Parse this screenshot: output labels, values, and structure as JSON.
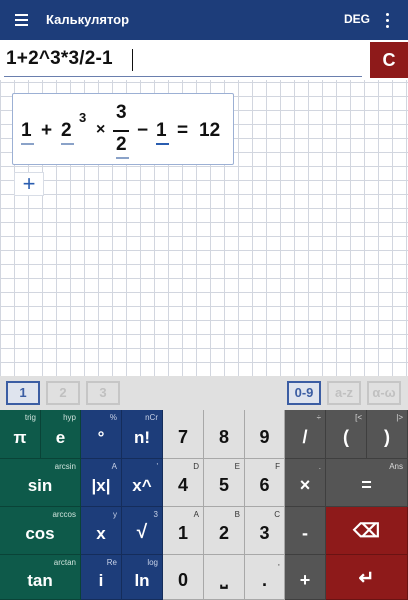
{
  "appbar": {
    "title": "Калькулятор",
    "angle_mode": "DEG"
  },
  "input": {
    "expression": "1+2^3*3/2-1",
    "clear_label": "C"
  },
  "result": {
    "t1": "1",
    "plus": "+",
    "t2": "2",
    "exp": "3",
    "times": "×",
    "num": "3",
    "den": "2",
    "minus": "−",
    "t3": "1",
    "eq": "=",
    "value": "12"
  },
  "add_label": "+",
  "keyboard_tabs": {
    "left": [
      "1",
      "2",
      "3"
    ],
    "right": [
      "0-9",
      "a-z",
      "α-ω"
    ]
  },
  "keys": {
    "pi": {
      "main": "π",
      "sub": "trig"
    },
    "e": {
      "main": "e",
      "sub": "hyp"
    },
    "deg": {
      "main": "°",
      "sub": "%"
    },
    "fact": {
      "main": "n!",
      "sub": "nCr"
    },
    "sin": {
      "main": "sin",
      "sub": "arcsin"
    },
    "abs": {
      "main": "|x|",
      "sub": "A"
    },
    "pow": {
      "main": "x^",
      "sub": "'"
    },
    "cos": {
      "main": "cos",
      "sub": "arccos"
    },
    "x": {
      "main": "x",
      "sub": "y"
    },
    "sqrt": {
      "main": "√",
      "sub": "3"
    },
    "tan": {
      "main": "tan",
      "sub": "arctan"
    },
    "i": {
      "main": "i",
      "sub": "Re"
    },
    "ln": {
      "main": "ln",
      "sub": "log"
    },
    "n7": {
      "main": "7",
      "sub": ""
    },
    "n8": {
      "main": "8",
      "sub": ""
    },
    "n9": {
      "main": "9",
      "sub": ""
    },
    "n4": {
      "main": "4",
      "sub": "D"
    },
    "n5": {
      "main": "5",
      "sub": "E"
    },
    "n6": {
      "main": "6",
      "sub": "F"
    },
    "n1": {
      "main": "1",
      "sub": "A"
    },
    "n2": {
      "main": "2",
      "sub": "B"
    },
    "n3": {
      "main": "3",
      "sub": "C"
    },
    "n0": {
      "main": "0",
      "sub": ""
    },
    "space": {
      "main": "⎵",
      "sub": ""
    },
    "dot": {
      "main": ".",
      "sub": ","
    },
    "div": {
      "main": "/",
      "sub": "÷"
    },
    "lpar": {
      "main": "(",
      "sub": "[<"
    },
    "rpar": {
      "main": ")",
      "sub": "|>"
    },
    "mul": {
      "main": "×",
      "sub": "."
    },
    "equals": {
      "main": "=",
      "sub": "Ans"
    },
    "sub": {
      "main": "-",
      "sub": ""
    },
    "backspace": {
      "main": "⌫",
      "sub": ""
    },
    "add": {
      "main": "+",
      "sub": ""
    },
    "enter": {
      "main": "↵",
      "sub": ""
    }
  },
  "colors": {
    "appbar": "#1d3d7a",
    "key_green": "#0e5a4a",
    "key_blue": "#1d3d7a",
    "key_gray": "#555555",
    "key_red": "#8e1a1a",
    "accent": "#2a5db0"
  }
}
